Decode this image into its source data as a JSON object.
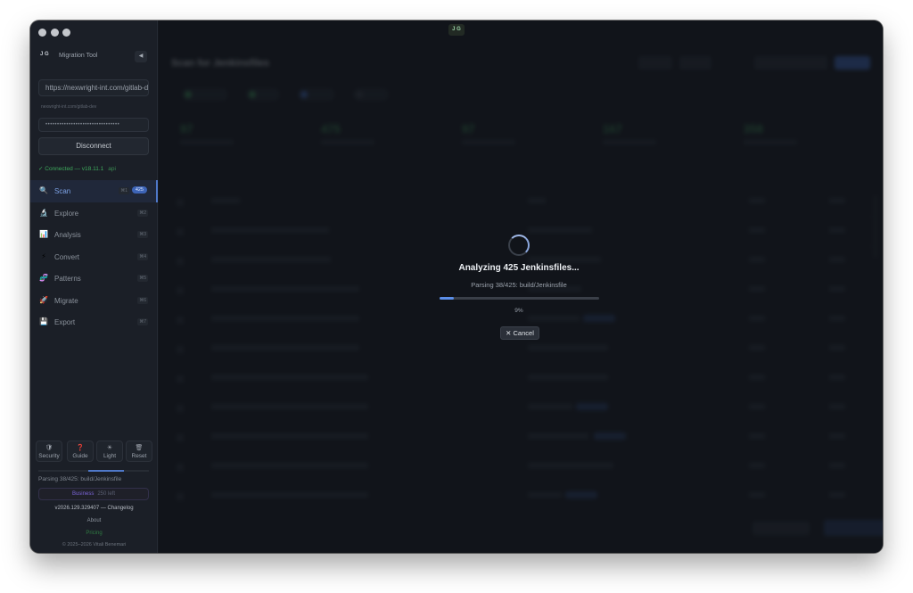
{
  "window": {
    "title_logo": "J G"
  },
  "sidebar": {
    "logo": "J G",
    "app_name": "Migration Tool",
    "collapse_icon": "◀",
    "url_value": "https://nexwright-int.com/gitlab-dev",
    "url_sub": "nexwright-int.com/gitlab-dev",
    "token_mask": "••••••••••••••••••••••••••••••••",
    "disconnect_label": "Disconnect",
    "connection": "✓ Connected — v18.11.1",
    "connection_api": "api",
    "nav": [
      {
        "label": "Scan",
        "key": "⌘1",
        "count": "425",
        "icon": "search-icon",
        "glyph": "🔍"
      },
      {
        "label": "Explore",
        "key": "⌘2",
        "icon": "microscope-icon",
        "glyph": "🔬"
      },
      {
        "label": "Analysis",
        "key": "⌘3",
        "icon": "chart-icon",
        "glyph": "📊"
      },
      {
        "label": "Convert",
        "key": "⌘4",
        "icon": "lightning-icon",
        "glyph": "⚡"
      },
      {
        "label": "Patterns",
        "key": "⌘5",
        "icon": "dna-icon",
        "glyph": "🧬"
      },
      {
        "label": "Migrate",
        "key": "⌘6",
        "icon": "rocket-icon",
        "glyph": "🚀"
      },
      {
        "label": "Export",
        "key": "⌘7",
        "icon": "floppy-icon",
        "glyph": "💾"
      }
    ],
    "tools": [
      {
        "label": "Security",
        "icon": "shield-icon",
        "glyph": "🛡"
      },
      {
        "label": "Guide",
        "icon": "question-icon",
        "glyph": "❓"
      },
      {
        "label": "Light",
        "icon": "sun-icon",
        "glyph": "☀"
      },
      {
        "label": "Reset",
        "icon": "trash-icon",
        "glyph": "🗑"
      }
    ],
    "status": "Parsing 38/425: build/Jenkinsfile",
    "plan_tier": "Business",
    "plan_left": "250 left",
    "version": "v2026.129.329407 — Changelog",
    "about": "About",
    "pricing": "Pricing",
    "copyright": "© 2025–2026 Vitali Benemari"
  },
  "main": {
    "page_title": "Scan for Jenkinsfiles",
    "stats": [
      "97",
      "475",
      "97",
      "167",
      "358"
    ],
    "accent": "#3f67b8",
    "success": "#3b8a55"
  },
  "modal": {
    "heading": "Analyzing 425 Jenkinsfiles...",
    "progress_text": "Parsing 38/425: build/Jenkinsfile",
    "progress_fraction": 0.09,
    "percent": "9%",
    "cancel_label": "✕ Cancel"
  }
}
